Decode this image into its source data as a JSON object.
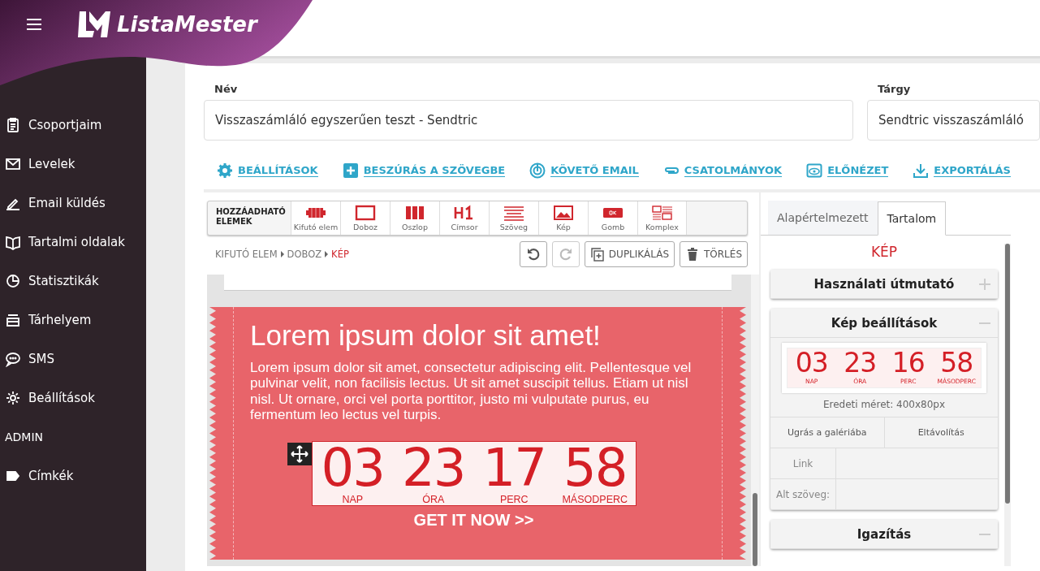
{
  "app": {
    "logo": "ListaMester"
  },
  "sidebar": {
    "items": [
      {
        "kind": "link",
        "label": "Csoportjaim"
      },
      {
        "kind": "link",
        "label": "Levelek"
      },
      {
        "kind": "link",
        "label": "Email küldés"
      },
      {
        "kind": "link",
        "label": "Tartalmi oldalak"
      },
      {
        "kind": "link",
        "label": "Statisztikák"
      },
      {
        "kind": "link",
        "label": "Tárhelyem"
      },
      {
        "kind": "link",
        "label": "SMS"
      },
      {
        "kind": "link",
        "label": "Beállítások"
      },
      {
        "kind": "heading",
        "label": "ADMIN"
      },
      {
        "kind": "link",
        "label": "Címkék"
      }
    ]
  },
  "form": {
    "fields": [
      {
        "label": "Név",
        "value": "Visszaszámláló egyszerűen teszt - Sendtric"
      },
      {
        "label": "Tárgy",
        "value": "Sendtric visszaszámláló"
      }
    ]
  },
  "actions": [
    "BEÁLLÍTÁSOK",
    "BESZÚRÁS A SZÖVEGBE",
    "KÖVETŐ EMAIL",
    "CSATOLMÁNYOK",
    "ELŐNÉZET",
    "EXPORTÁLÁS"
  ],
  "palette": {
    "title": "HOZZÁADHATÓ ELEMEK",
    "items": [
      "Kifutó elem",
      "Doboz",
      "Oszlop",
      "Címsor",
      "Szöveg",
      "Kép",
      "Gomb",
      "Komplex"
    ]
  },
  "breadcrumb": [
    {
      "label": "KIFUTÓ ELEM",
      "selected": false
    },
    {
      "label": "DOBOZ",
      "selected": false
    },
    {
      "label": "KÉP",
      "selected": true
    }
  ],
  "edit_buttons": [
    {
      "kind": "undo",
      "disabled": false
    },
    {
      "kind": "redo",
      "disabled": true
    },
    {
      "kind": "duplicate",
      "label": "DUPLIKÁLÁS",
      "disabled": false
    },
    {
      "kind": "delete",
      "label": "TÖRLÉS",
      "disabled": false
    }
  ],
  "canvas": {
    "heading": "Lorem ipsum dolor sit amet!",
    "body": "Lorem ipsum dolor sit amet, consectetur adipiscing elit. Pellentesque vel pulvinar velit, non facilisis lectus. Ut sit amet suscipit tellus. Etiam ut nisl nisl. Ut ornare, orci vel porta porttitor, justo mi vulputate purus, eu fermentum leo lectus vel turpis.",
    "countdown": [
      {
        "value": "03",
        "label": "NAP"
      },
      {
        "value": "23",
        "label": "ÓRA"
      },
      {
        "value": "17",
        "label": "PERC"
      },
      {
        "value": "58",
        "label": "MÁSODPERC"
      }
    ],
    "cta": "GET IT NOW >>"
  },
  "panel": {
    "tabs": [
      {
        "label": "Alapértelmezett",
        "selected": false
      },
      {
        "label": "Tartalom",
        "selected": true
      }
    ],
    "element_title": "KÉP",
    "sections": [
      {
        "title": "Használati útmutató",
        "expanded": false
      },
      {
        "title": "Kép beállítások",
        "expanded": true,
        "kind": "image",
        "preview": [
          {
            "value": "03",
            "label": "NAP"
          },
          {
            "value": "23",
            "label": "ÓRA"
          },
          {
            "value": "16",
            "label": "PERC"
          },
          {
            "value": "58",
            "label": "MÁSODPERC"
          }
        ],
        "size": "Eredeti méret: 400x80px",
        "buttons": [
          "Ugrás a galériába",
          "Eltávolítás"
        ],
        "fields": [
          {
            "label": "Link"
          },
          {
            "label": "Alt szöveg:"
          }
        ]
      },
      {
        "title": "Igazítás",
        "expanded": true
      }
    ]
  }
}
